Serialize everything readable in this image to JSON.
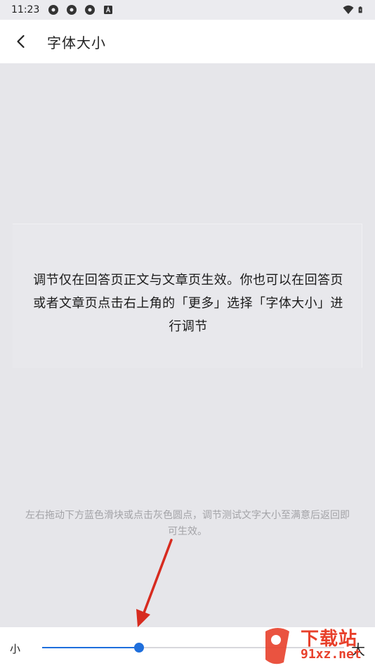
{
  "status_bar": {
    "time": "11:23"
  },
  "header": {
    "title": "字体大小"
  },
  "preview": {
    "text": "调节仅在回答页正文与文章页生效。你也可以在回答页或者文章页点击右上角的「更多」选择「字体大小」进行调节"
  },
  "hint": {
    "text": "左右拖动下方蓝色滑块或点击灰色圆点，调节测试文字大小至满意后返回即可生效。"
  },
  "slider": {
    "small_label": "小",
    "large_label": "大",
    "value_fraction": 0.32
  },
  "watermark": {
    "brand": "下载站",
    "url": "91xz.net"
  },
  "colors": {
    "accent": "#1f6fdc",
    "annotation_arrow": "#d72b1f"
  }
}
